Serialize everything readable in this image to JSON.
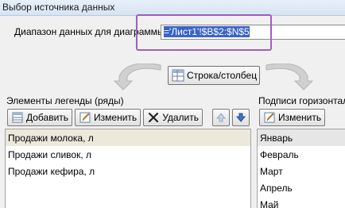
{
  "window": {
    "title": "Выбор источника данных"
  },
  "range": {
    "label": "Диапазон данных для диаграммы:",
    "value": "='Лист1'!$B$2:$N$5"
  },
  "switch_button": {
    "label": "Строка/столбец"
  },
  "legend": {
    "title": "Элементы легенды (ряды)",
    "buttons": {
      "add": "Добавить",
      "edit": "Изменить",
      "delete": "Удалить"
    },
    "items": [
      "Продажи молока, л",
      "Продажи сливок, л",
      "Продажи кефира, л"
    ]
  },
  "axis": {
    "title": "Подписи горизонтал",
    "edit_button": "Изменить",
    "items": [
      "Январь",
      "Февраль",
      "Март",
      "Апрель",
      "Май"
    ]
  },
  "colors": {
    "highlight": "#9e5fbe",
    "selection": "#3a64c9",
    "title_bar": "#dce7f3"
  }
}
